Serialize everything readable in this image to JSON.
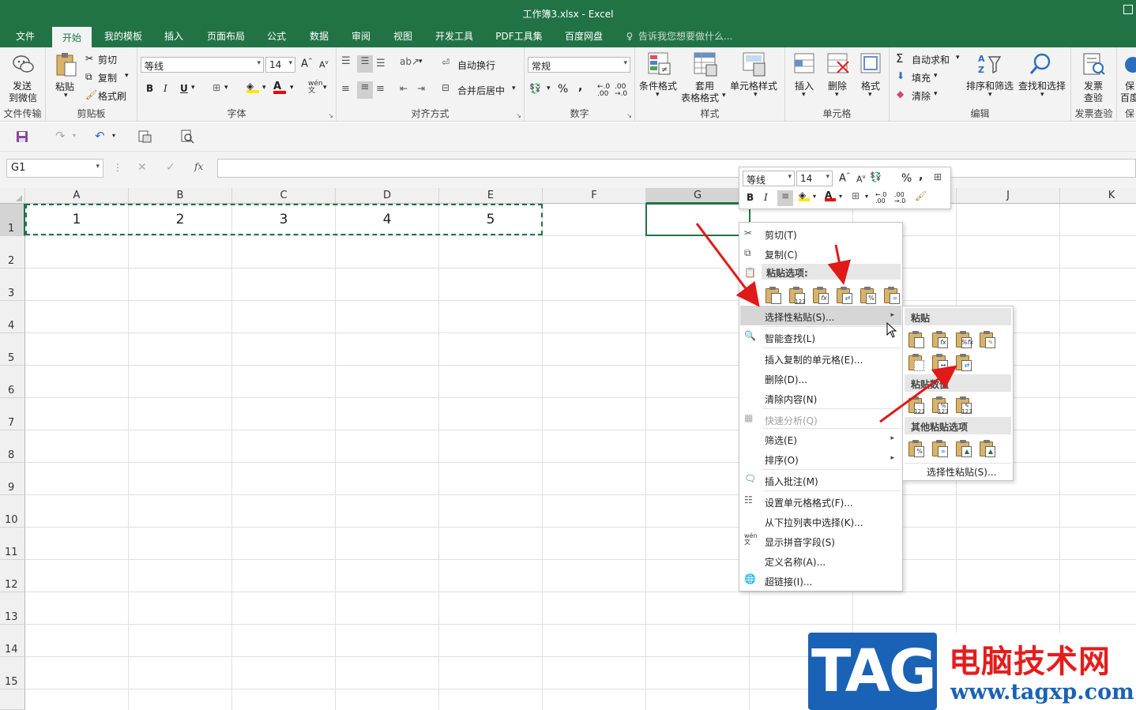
{
  "window": {
    "title": "工作簿3.xlsx - Excel"
  },
  "menu": {
    "tabs": [
      "文件",
      "开始",
      "我的模板",
      "插入",
      "页面布局",
      "公式",
      "数据",
      "审阅",
      "视图",
      "开发工具",
      "PDF工具集",
      "百度网盘"
    ],
    "active_tab": "开始",
    "tellme": "告诉我您想要做什么..."
  },
  "ribbon": {
    "wechat": {
      "line1": "发送",
      "line2": "到微信",
      "group": "文件传输"
    },
    "clipboard": {
      "paste": "粘贴",
      "cut": "剪切",
      "copy": "复制",
      "format_painter": "格式刷",
      "group": "剪贴板"
    },
    "font": {
      "name": "等线",
      "size": "14",
      "bold": "B",
      "italic": "I",
      "underline": "U",
      "group": "字体"
    },
    "alignment": {
      "wrap": "自动换行",
      "merge": "合并后居中",
      "group": "对齐方式"
    },
    "number": {
      "format": "常规",
      "percent": "%",
      "comma": ",",
      "group": "数字"
    },
    "styles": {
      "conditional": "条件格式",
      "table1": "套用",
      "table2": "表格格式",
      "cell_styles": "单元格样式",
      "group": "样式"
    },
    "cells": {
      "insert": "插入",
      "delete": "删除",
      "format": "格式",
      "group": "单元格"
    },
    "editing": {
      "autosum": "自动求和",
      "fill": "填充",
      "clear": "清除",
      "sort": "排序和筛选",
      "find": "查找和选择",
      "group": "编辑"
    },
    "invoice": {
      "line1": "发票",
      "line2": "查验",
      "group": "发票查验"
    },
    "baidu": {
      "line1": "保",
      "line2": "百度",
      "group": "保"
    }
  },
  "namebox": "G1",
  "fx_label": "fx",
  "columns": [
    "A",
    "B",
    "C",
    "D",
    "E",
    "F",
    "G",
    "H",
    "I",
    "J",
    "K"
  ],
  "rows": [
    "1",
    "2",
    "3",
    "4",
    "5",
    "6",
    "7",
    "8",
    "9",
    "10",
    "11",
    "12",
    "13",
    "14",
    "15"
  ],
  "cells": {
    "A1": "1",
    "B1": "2",
    "C1": "3",
    "D1": "4",
    "E1": "5"
  },
  "mini_toolbar": {
    "font": "等线",
    "size": "14",
    "bold": "B",
    "italic": "I",
    "percent": "%",
    "comma": ","
  },
  "context_menu": {
    "cut": "剪切(T)",
    "copy": "复制(C)",
    "paste_options": "粘贴选项:",
    "paste_special": "选择性粘贴(S)...",
    "smart_lookup": "智能查找(L)",
    "insert_copied": "插入复制的单元格(E)...",
    "delete": "删除(D)...",
    "clear": "清除内容(N)",
    "quick_analysis": "快速分析(Q)",
    "filter": "筛选(E)",
    "sort": "排序(O)",
    "insert_comment": "插入批注(M)",
    "format_cells": "设置单元格格式(F)...",
    "pick_list": "从下拉列表中选择(K)...",
    "phonetic": "显示拼音字段(S)",
    "define_name": "定义名称(A)...",
    "hyperlink": "超链接(I)..."
  },
  "submenu": {
    "paste": "粘贴",
    "paste_values": "粘贴数值",
    "other": "其他粘贴选项",
    "paste_special": "选择性粘贴(S)..."
  },
  "watermark": {
    "tag": "TAG",
    "name": "电脑技术网",
    "url": "www.tagxp.com"
  },
  "colors": {
    "excel_green": "#217346",
    "arrow_red": "#e01919",
    "tag_blue": "#1a62b5"
  }
}
